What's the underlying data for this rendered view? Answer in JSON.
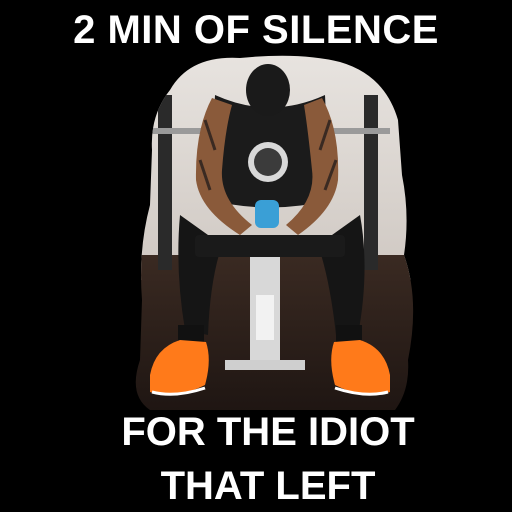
{
  "meme": {
    "top_text": "2 MIN OF SILENCE",
    "bottom_text_line1": "FOR THE IDIOT",
    "bottom_text_line2": "THAT LEFT"
  },
  "colors": {
    "background": "#000000",
    "text": "#ffffff",
    "shoes": "#ff7a1a",
    "bottle": "#3a9fd6"
  },
  "photo": {
    "subject": "man-in-jersey-sitting-on-bench-head-down-icon"
  }
}
